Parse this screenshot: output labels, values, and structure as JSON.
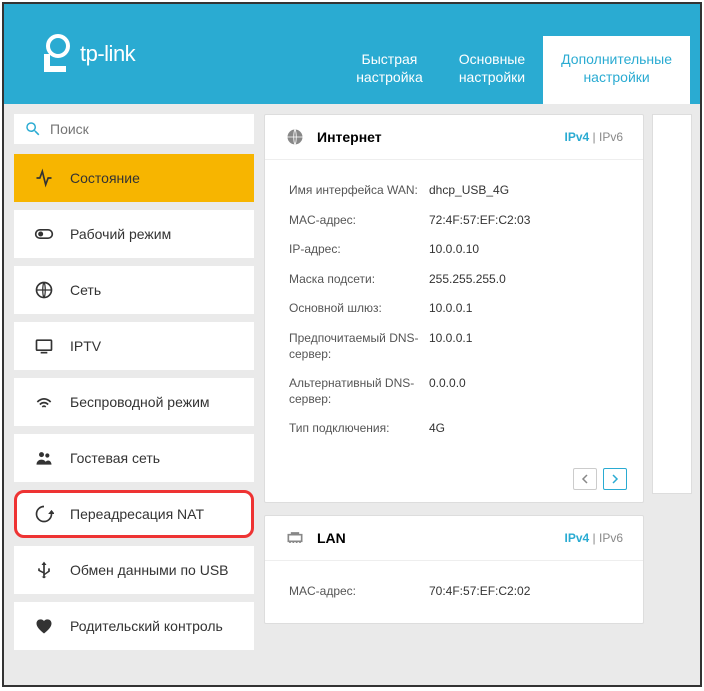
{
  "logo": {
    "text": "tp-link"
  },
  "tabs": [
    {
      "line1": "Быстрая",
      "line2": "настройка"
    },
    {
      "line1": "Основные",
      "line2": "настройки"
    },
    {
      "line1": "Дополнительные",
      "line2": "настройки"
    }
  ],
  "search": {
    "placeholder": "Поиск"
  },
  "menu": {
    "status": "Состояние",
    "mode": "Рабочий режим",
    "network": "Сеть",
    "iptv": "IPTV",
    "wireless": "Беспроводной режим",
    "guest": "Гостевая сеть",
    "nat": "Переадресация NAT",
    "usb": "Обмен данными по USB",
    "parental": "Родительский контроль"
  },
  "internet": {
    "title": "Интернет",
    "ipv4": "IPv4",
    "ipv6": "IPv6",
    "rows": {
      "wan_if_label": "Имя интерфейса WAN:",
      "wan_if_value": "dhcp_USB_4G",
      "mac_label": "MAC-адрес:",
      "mac_value": "72:4F:57:EF:C2:03",
      "ip_label": "IP-адрес:",
      "ip_value": "10.0.0.10",
      "mask_label": "Маска подсети:",
      "mask_value": "255.255.255.0",
      "gw_label": "Основной шлюз:",
      "gw_value": "10.0.0.1",
      "dns1_label": "Предпочитаемый DNS-сервер:",
      "dns1_value": "10.0.0.1",
      "dns2_label": "Альтернативный DNS-сервер:",
      "dns2_value": "0.0.0.0",
      "type_label": "Тип подключения:",
      "type_value": "4G"
    }
  },
  "lan": {
    "title": "LAN",
    "ipv4": "IPv4",
    "ipv6": "IPv6",
    "mac_label": "MAC-адрес:",
    "mac_value": "70:4F:57:EF:C2:02"
  }
}
